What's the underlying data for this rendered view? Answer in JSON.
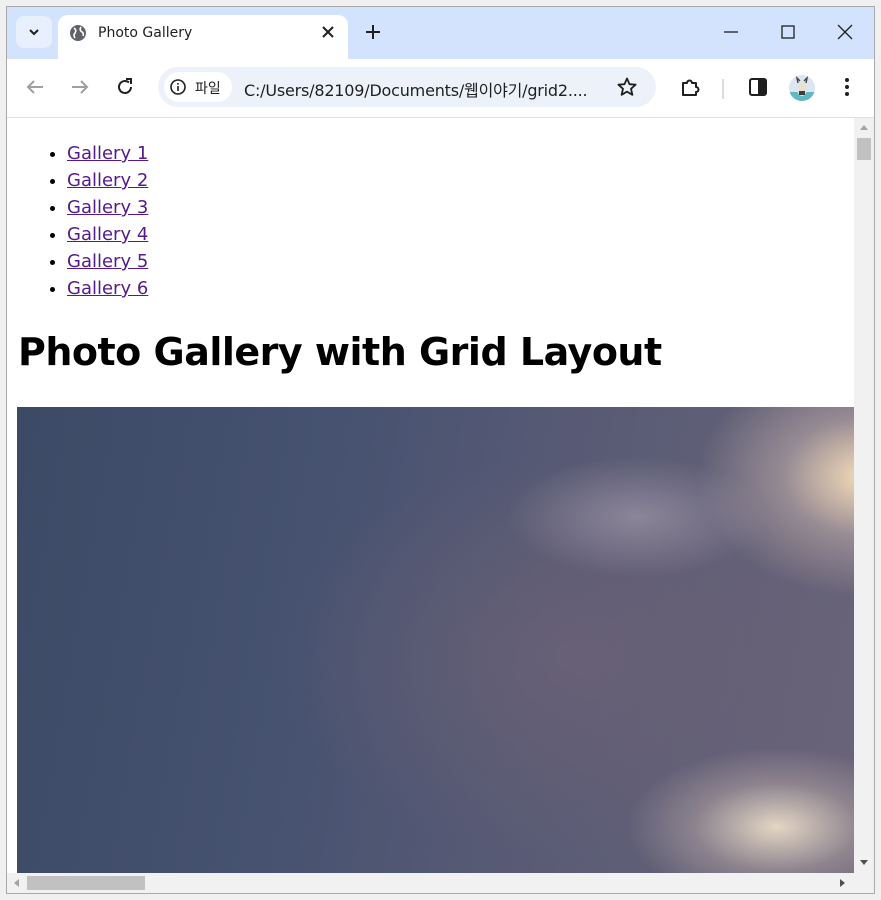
{
  "browser": {
    "tab_title": "Photo Gallery",
    "chip_label": "파일",
    "url": "C:/Users/82109/Documents/웹이야기/grid2....",
    "icons": {
      "tab_search": "chevron-down-icon",
      "tab_favicon": "globe-icon",
      "tab_close": "close-icon",
      "new_tab": "plus-icon",
      "minimize": "minimize-icon",
      "maximize": "maximize-icon",
      "close_window": "close-icon",
      "back": "arrow-left-icon",
      "forward": "arrow-right-icon",
      "reload": "reload-icon",
      "site_info": "info-icon",
      "bookmark": "star-icon",
      "extensions": "puzzle-icon",
      "side_panel": "side-panel-icon",
      "profile": "avatar",
      "menu": "kebab-menu-icon"
    }
  },
  "page": {
    "nav": [
      {
        "label": "Gallery 1"
      },
      {
        "label": "Gallery 2"
      },
      {
        "label": "Gallery 3"
      },
      {
        "label": "Gallery 4"
      },
      {
        "label": "Gallery 5"
      },
      {
        "label": "Gallery 6"
      }
    ],
    "heading": "Photo Gallery with Grid Layout",
    "link_color": "#551a8b"
  }
}
